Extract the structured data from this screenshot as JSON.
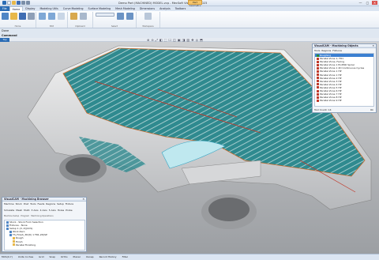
{
  "window": {
    "title": "Demo Part (MACHINED) MODEL.vcp - MecSoft VisualCAM 2023",
    "context_tab": "Part Geometry",
    "buttons": [
      "—",
      "▢",
      "✕"
    ]
  },
  "ribbon_tabs": [
    "File",
    "Home",
    "Display",
    "Modeling Utils",
    "Curve Modeling",
    "Surface Modeling",
    "Mesh Modeling",
    "Dimensions",
    "Analysis",
    "Toolbars"
  ],
  "ribbon_groups": [
    {
      "label": "Home"
    },
    {
      "label": "Edit"
    },
    {
      "label": "Clipboard"
    },
    {
      "label": "Select"
    },
    {
      "label": "Workspace"
    }
  ],
  "done_text": "Done",
  "command_label": "Command",
  "viewport_label": "Top View",
  "view_icons": [
    "⊕",
    "⊖",
    "⤢",
    "◧",
    "⬚",
    "☐",
    "◫",
    "▣",
    "◨",
    "▥",
    "✥",
    "◎",
    "⬒"
  ],
  "machining_objects": {
    "title": "VisualCAM - Machining Objects",
    "close": "✕",
    "toolbar": [
      "Tools",
      "Regions",
      "Fixtures"
    ],
    "items": [
      "Roughing",
      "Parallel Zone 1, FR1",
      "Parallel Zone, Facing",
      "Parallel Zone 1 EndMill Spiral",
      "Parallel Zone 1 2D Continuous Cycles",
      "Parallel Zone 1 HP",
      "Parallel Zone 1 HP",
      "Parallel Zone 2 HP",
      "Parallel Zone 3 HP",
      "Parallel Zone 4 HP",
      "Parallel Zone 5 HP",
      "Parallel Zone 6 HP",
      "Parallel Zone 7 HP",
      "Parallel Zone 8 HP",
      "Parallel Zone 9 HP"
    ],
    "item_colors": [
      "#2e8b2e",
      "#c0392b",
      "#c0392b",
      "#c0392b",
      "#c0392b",
      "#c0392b",
      "#c0392b",
      "#c0392b",
      "#c0392b",
      "#c0392b",
      "#c0392b",
      "#c0392b",
      "#c0392b",
      "#c0392b",
      "#c0392b"
    ],
    "footer": "Tool Count: 14",
    "footer_right": "Ok"
  },
  "machining_browser": {
    "title": "VisualCAM - Machining Browser",
    "close": "✕",
    "toolbar": [
      "Machine",
      "Stock",
      "Post",
      "Tools",
      "Feeds",
      "Regions",
      "Setup",
      "Fixture",
      "Simulate",
      "Mesh",
      "Multi",
      "3 Axis",
      "4 Axis",
      "5 Axis",
      "Holes",
      "Probe"
    ],
    "sections": [
      "Machine Setup",
      "Program",
      "Machining Operations"
    ],
    "tree": [
      "Stock - Stock From Selection",
      "Fixtures - None",
      "Setup 1 (X, Z)(UCS)",
      "Work Zero",
      "TS_Finish_3D(D) 1 FR1-2D(SP",
      "Rough",
      "Finish",
      "Parallel Finishing"
    ]
  },
  "status_bar": [
    "MCS(X,Y)",
    "Units: Inches",
    "Grid",
    "Snap",
    "Ortho",
    "Planar",
    "Osnap",
    "Record History",
    "Filter"
  ]
}
